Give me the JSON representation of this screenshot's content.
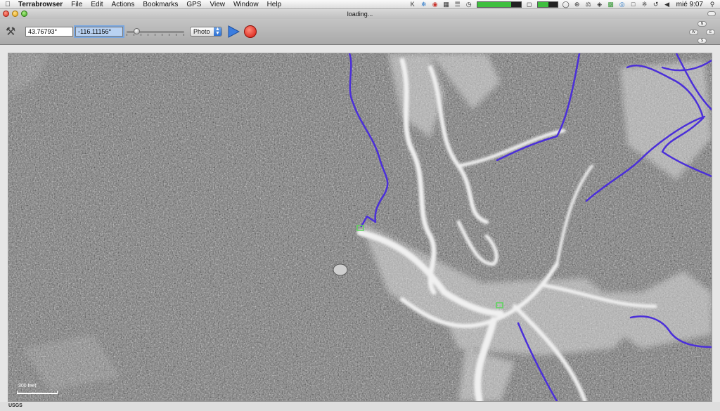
{
  "menubar": {
    "app_name": "Terrabrowser",
    "items": [
      "File",
      "Edit",
      "Actions",
      "Bookmarks",
      "GPS",
      "View",
      "Window",
      "Help"
    ],
    "clock": "mié 9:07"
  },
  "window": {
    "title": "loading..."
  },
  "toolbar": {
    "latitude": "43.76793°",
    "longitude": "-116.11156°",
    "map_type": "Photo"
  },
  "compass": {
    "north": "N",
    "west": "W",
    "east": "E",
    "south": "S"
  },
  "map": {
    "scale_label": "300 feet",
    "attribution": "USGS",
    "track_color": "#4b2fd9",
    "waypoint_color": "#5cd65c"
  }
}
